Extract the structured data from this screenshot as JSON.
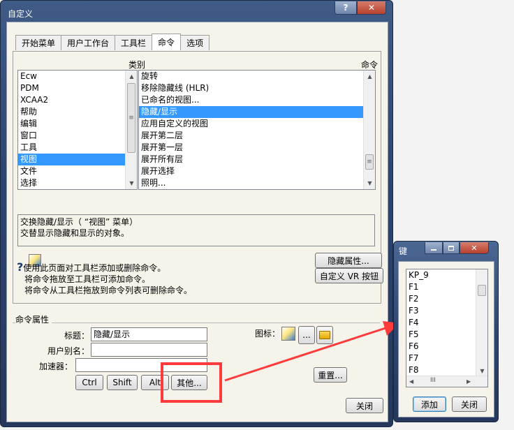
{
  "main_window": {
    "title": "自定义",
    "help_label": "?",
    "close_label": "✕",
    "tabs": [
      "开始菜单",
      "用户工作台",
      "工具栏",
      "命令",
      "选项"
    ],
    "active_tab": "命令",
    "category_header": "类别",
    "command_header": "命令",
    "categories": [
      "Ecw",
      "PDM",
      "XCAA2",
      "帮助",
      "编辑",
      "窗口",
      "工具",
      "视图",
      "文件",
      "选择"
    ],
    "selected_category": "视图",
    "commands": [
      "旋转",
      "移除隐藏线 (HLR)",
      "已命名的视图...",
      "隐藏/显示",
      "应用自定义的视图",
      "展开第二层",
      "展开第一层",
      "展开所有层",
      "展开选择",
      "照明..."
    ],
    "selected_command": "隐藏/显示",
    "description_line1": "交换隐藏/显示（ “视图” 菜单）",
    "description_line2": "交替显示隐藏和显示的对象。",
    "hide_props_button": "隐藏属性...",
    "custom_vr_button": "自定义 VR 按钮",
    "help_lines": [
      "使用此页面对工具栏添加或删除命令。",
      "将命令拖放至工具栏可添加命令。",
      "将命令从工具栏拖放到命令列表可删除命令。"
    ],
    "cmd_props_title": "命令属性",
    "title_label": "标题：",
    "title_value": "隐藏/显示",
    "alias_label": "用户别名：",
    "alias_value": "",
    "accel_label": "加速器：",
    "accel_value": "",
    "icon_label": "图标：",
    "ellipsis_button": "...",
    "ctrl_button": "Ctrl",
    "shift_button": "Shift",
    "alt_button": "Alt",
    "other_button": "其他...",
    "reset_button": "重置...",
    "close_button": "关闭"
  },
  "key_dialog": {
    "title": "键",
    "keys": [
      "KP_9",
      "F1",
      "F2",
      "F3",
      "F4",
      "F5",
      "F6",
      "F7",
      "F8"
    ],
    "scroll_mid": "III",
    "add_button": "添加",
    "close_button": "关闭"
  },
  "colors": {
    "annotation": "#ff3b3b",
    "selection": "#3399ff"
  }
}
